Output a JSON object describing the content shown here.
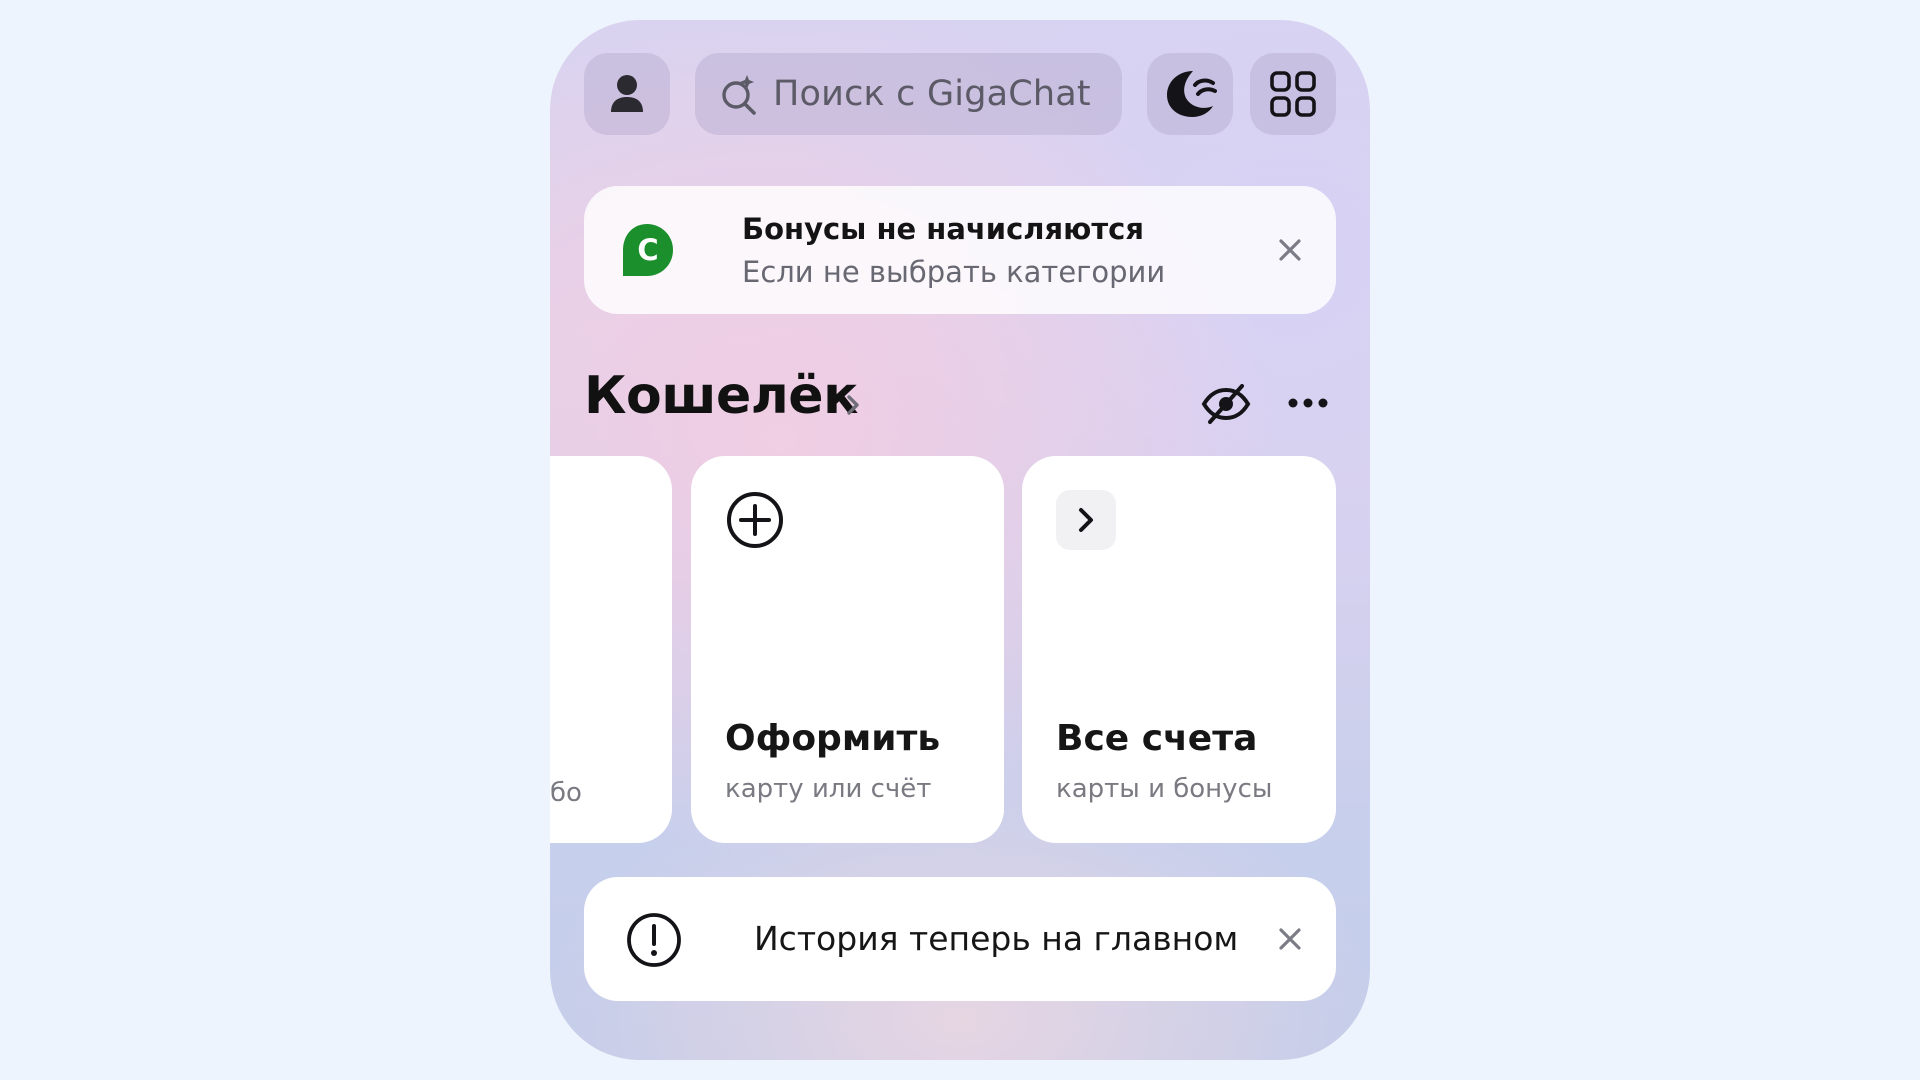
{
  "header": {
    "profile_icon": "person-icon",
    "search": {
      "icon": "sparkle-search-icon",
      "placeholder": "Поиск с GigaChat"
    },
    "assistant_icon": "crescent-moon-icon",
    "menu_icon": "grid-icon"
  },
  "bonus_banner": {
    "logo_icon": "sber-spasibo-logo",
    "logo_color": "#1a8f2c",
    "title": "Бонусы не начисляются",
    "subtitle": "Если не выбрать категории",
    "close_icon": "close-icon"
  },
  "wallet": {
    "title": "Кошелёк",
    "hide_icon": "eye-off-icon",
    "more_icon": "more-dots-icon",
    "cards": [
      {
        "title": "",
        "subtitle": "бо"
      },
      {
        "icon": "plus-circle-icon",
        "title": "Оформить",
        "subtitle": "карту или счёт"
      },
      {
        "icon": "chevron-right-icon",
        "title": "Все счета",
        "subtitle": "карты и бонусы"
      }
    ]
  },
  "history_banner": {
    "icon": "alert-circle-icon",
    "text": "История теперь на главном",
    "close_icon": "close-icon"
  }
}
